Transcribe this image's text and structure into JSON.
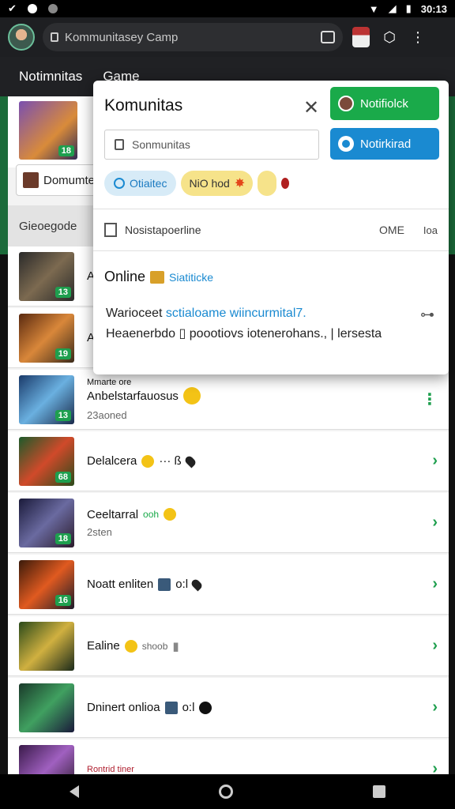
{
  "status": {
    "time": "30:13"
  },
  "browser": {
    "url": "Kommunitasey Camp"
  },
  "tabs": [
    "Notimnitas",
    "Game"
  ],
  "background": {
    "chip_label": "Domumte",
    "category_label": "Gieoegode"
  },
  "rows": [
    {
      "title": "A",
      "sub": "",
      "level": "13"
    },
    {
      "title": "A",
      "sub": "",
      "level": "19"
    },
    {
      "title": "Anbelstarfauosus",
      "pre": "Mmarte ore",
      "sub": "23aoned",
      "level": "13"
    },
    {
      "title": "Delalcera",
      "extra": "··· ß",
      "sub": "",
      "level": "68"
    },
    {
      "title": "Ceeltarral",
      "extra": "ooh",
      "sub": "2sten",
      "level": "18"
    },
    {
      "title": "Noatt enliten",
      "extra": "o:l",
      "sub": "",
      "level": "16"
    },
    {
      "title": "Ealine",
      "extra": "shoob",
      "sub": "",
      "level": ""
    },
    {
      "title": "Dninert onlioa",
      "extra": "o:l",
      "sub": "",
      "level": ""
    },
    {
      "title": "Rontrid tiner",
      "sub": "",
      "level": ""
    }
  ],
  "modal": {
    "title": "Komunitas",
    "btn_notif": "Notifiolck",
    "btn_download": "Notirkirad",
    "search_placeholder": "Sonmunitas",
    "chip_online": "Otiaitec",
    "chip_hot": "NiO hod",
    "list_label": "Nosistapoerline",
    "list_right1": "OME",
    "list_right2": "Ioa",
    "online_label": "Online",
    "online_link": "Siatiticke",
    "desc_line1_a": "Warioceet ",
    "desc_line1_b": "sctialoame wiincurmital7.",
    "desc_line2": "Heaenerbdo ▯ poootiovs iotenerohans., | lersesta"
  },
  "colors": {
    "accent_green": "#1aaa4a",
    "accent_blue": "#1a8ad1"
  }
}
